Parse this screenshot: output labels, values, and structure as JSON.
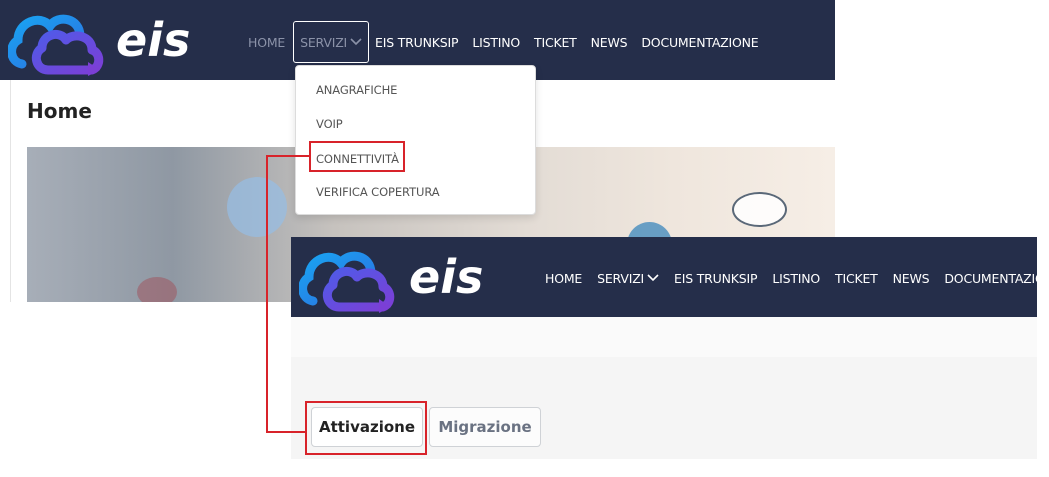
{
  "brand": {
    "name": "eis"
  },
  "screen1": {
    "nav": [
      {
        "label": "HOME"
      },
      {
        "label": "SERVIZI"
      },
      {
        "label": "EIS TRUNKSIP"
      },
      {
        "label": "LISTINO"
      },
      {
        "label": "TICKET"
      },
      {
        "label": "NEWS"
      },
      {
        "label": "DOCUMENTAZIONE"
      }
    ],
    "page_title": "Home",
    "dropdown": [
      {
        "label": "ANAGRAFICHE"
      },
      {
        "label": "VOIP"
      },
      {
        "label": "CONNETTIVITÀ"
      },
      {
        "label": "VERIFICA COPERTURA"
      }
    ]
  },
  "screen2": {
    "nav": [
      {
        "label": "HOME"
      },
      {
        "label": "SERVIZI"
      },
      {
        "label": "EIS TRUNKSIP"
      },
      {
        "label": "LISTINO"
      },
      {
        "label": "TICKET"
      },
      {
        "label": "NEWS"
      },
      {
        "label": "DOCUMENTAZIONE"
      }
    ],
    "tabs": [
      {
        "label": "Attivazione"
      },
      {
        "label": "Migrazione"
      }
    ]
  },
  "colors": {
    "navbar": "#252e4a",
    "highlight": "#d8232a",
    "logo_blue": "#1e90e6",
    "logo_purple": "#6a3fd8"
  },
  "icons": [
    "eis-cloud-logo-icon",
    "chevron-down-icon"
  ]
}
